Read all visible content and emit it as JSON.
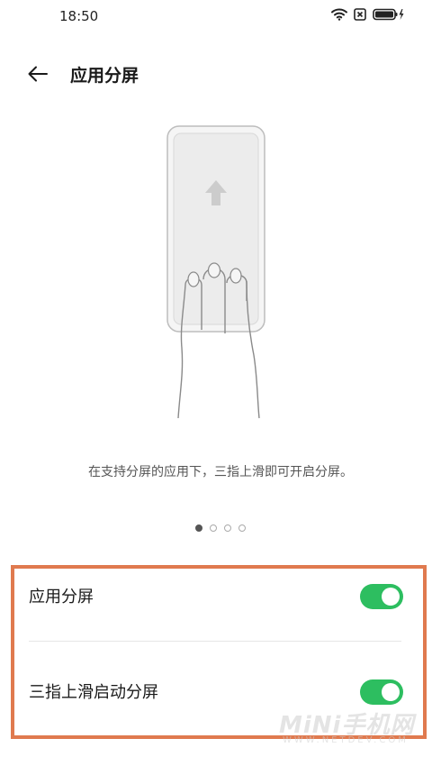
{
  "status_bar": {
    "time": "18:50",
    "icons": [
      "wifi-icon",
      "sim-blocked-icon",
      "battery-charging-icon"
    ]
  },
  "header": {
    "back_icon": "arrow-left-icon",
    "title": "应用分屏"
  },
  "illustration": {
    "icon": "three-finger-swipe-up-illustration"
  },
  "description": "在支持分屏的应用下，三指上滑即可开启分屏。",
  "pagination": {
    "total": 4,
    "active_index": 0
  },
  "settings": [
    {
      "label": "应用分屏",
      "enabled": true
    },
    {
      "label": "三指上滑启动分屏",
      "enabled": true
    }
  ],
  "watermark": {
    "brand": "MiNi手机网",
    "url": "WWW.NETDEV.COM"
  },
  "colors": {
    "toggle_on": "#2dbe60",
    "highlight_border": "#e07a4f"
  }
}
